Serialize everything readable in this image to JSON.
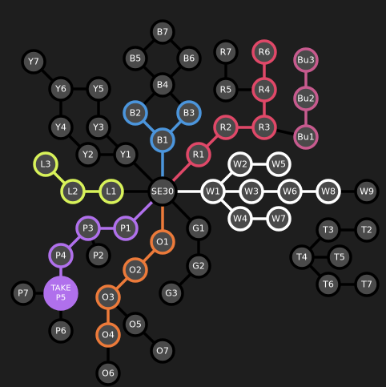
{
  "colors": {
    "background": "#1e1e1e",
    "node_fill": "#4a4a4a",
    "node_ring_default": "#000000",
    "edge_default": "#000000",
    "unlocked_branch": "#ffffff",
    "blue": "#4b95dc",
    "red": "#e04868",
    "pink": "#c75a8e",
    "lime": "#d8f25a",
    "purple": "#b070ec",
    "orange": "#ec7a3a",
    "take_fill": "#b070ec"
  },
  "center": {
    "id": "SE30",
    "label": "SE30"
  },
  "nodes": [
    {
      "id": "B7",
      "label": "B7"
    },
    {
      "id": "B5",
      "label": "B5"
    },
    {
      "id": "B6",
      "label": "B6"
    },
    {
      "id": "B4",
      "label": "B4"
    },
    {
      "id": "B2",
      "label": "B2"
    },
    {
      "id": "B3",
      "label": "B3"
    },
    {
      "id": "B1",
      "label": "B1"
    },
    {
      "id": "R7",
      "label": "R7"
    },
    {
      "id": "R6",
      "label": "R6"
    },
    {
      "id": "R5",
      "label": "R5"
    },
    {
      "id": "R4",
      "label": "R4"
    },
    {
      "id": "R3",
      "label": "R3"
    },
    {
      "id": "R2",
      "label": "R2"
    },
    {
      "id": "R1",
      "label": "R1"
    },
    {
      "id": "Bu3",
      "label": "Bu3"
    },
    {
      "id": "Bu2",
      "label": "Bu2"
    },
    {
      "id": "Bu1",
      "label": "Bu1"
    },
    {
      "id": "Y7",
      "label": "Y7"
    },
    {
      "id": "Y6",
      "label": "Y6"
    },
    {
      "id": "Y5",
      "label": "Y5"
    },
    {
      "id": "Y4",
      "label": "Y4"
    },
    {
      "id": "Y3",
      "label": "Y3"
    },
    {
      "id": "Y2",
      "label": "Y2"
    },
    {
      "id": "Y1",
      "label": "Y1"
    },
    {
      "id": "L3",
      "label": "L3"
    },
    {
      "id": "L2",
      "label": "L2"
    },
    {
      "id": "L1",
      "label": "L1"
    },
    {
      "id": "W1",
      "label": "W1"
    },
    {
      "id": "W2",
      "label": "W2"
    },
    {
      "id": "W3",
      "label": "W3"
    },
    {
      "id": "W4",
      "label": "W4"
    },
    {
      "id": "W5",
      "label": "W5"
    },
    {
      "id": "W6",
      "label": "W6"
    },
    {
      "id": "W7",
      "label": "W7"
    },
    {
      "id": "W8",
      "label": "W8"
    },
    {
      "id": "W9",
      "label": "W9"
    },
    {
      "id": "P1",
      "label": "P1"
    },
    {
      "id": "P2",
      "label": "P2"
    },
    {
      "id": "P3",
      "label": "P3"
    },
    {
      "id": "P4",
      "label": "P4"
    },
    {
      "id": "P5",
      "label": "TAKE\nP5"
    },
    {
      "id": "P6",
      "label": "P6"
    },
    {
      "id": "P7",
      "label": "P7"
    },
    {
      "id": "O1",
      "label": "O1"
    },
    {
      "id": "O2",
      "label": "O2"
    },
    {
      "id": "O3",
      "label": "O3"
    },
    {
      "id": "O4",
      "label": "O4"
    },
    {
      "id": "O5",
      "label": "O5"
    },
    {
      "id": "O6",
      "label": "O6"
    },
    {
      "id": "O7",
      "label": "O7"
    },
    {
      "id": "G1",
      "label": "G1"
    },
    {
      "id": "G2",
      "label": "G2"
    },
    {
      "id": "G3",
      "label": "G3"
    },
    {
      "id": "T2",
      "label": "T2"
    },
    {
      "id": "T3",
      "label": "T3"
    },
    {
      "id": "T4",
      "label": "T4"
    },
    {
      "id": "T5",
      "label": "T5"
    },
    {
      "id": "T6",
      "label": "T6"
    },
    {
      "id": "T7",
      "label": "T7"
    }
  ],
  "branch_state": {
    "B1": "blue",
    "B2": "blue",
    "B3": "blue",
    "R1": "red",
    "R2": "red",
    "R3": "red",
    "R4": "red",
    "R6": "red",
    "Bu1": "pink",
    "Bu2": "pink",
    "Bu3": "pink",
    "L1": "lime",
    "L2": "lime",
    "L3": "lime",
    "W1": "white",
    "W2": "white",
    "W3": "white",
    "W4": "white",
    "W5": "white",
    "W6": "white",
    "W7": "white",
    "W8": "white",
    "P1": "purple",
    "P3": "purple",
    "P4": "purple",
    "P5": "take",
    "O1": "orange",
    "O2": "orange",
    "O3": "orange",
    "O4": "orange"
  }
}
